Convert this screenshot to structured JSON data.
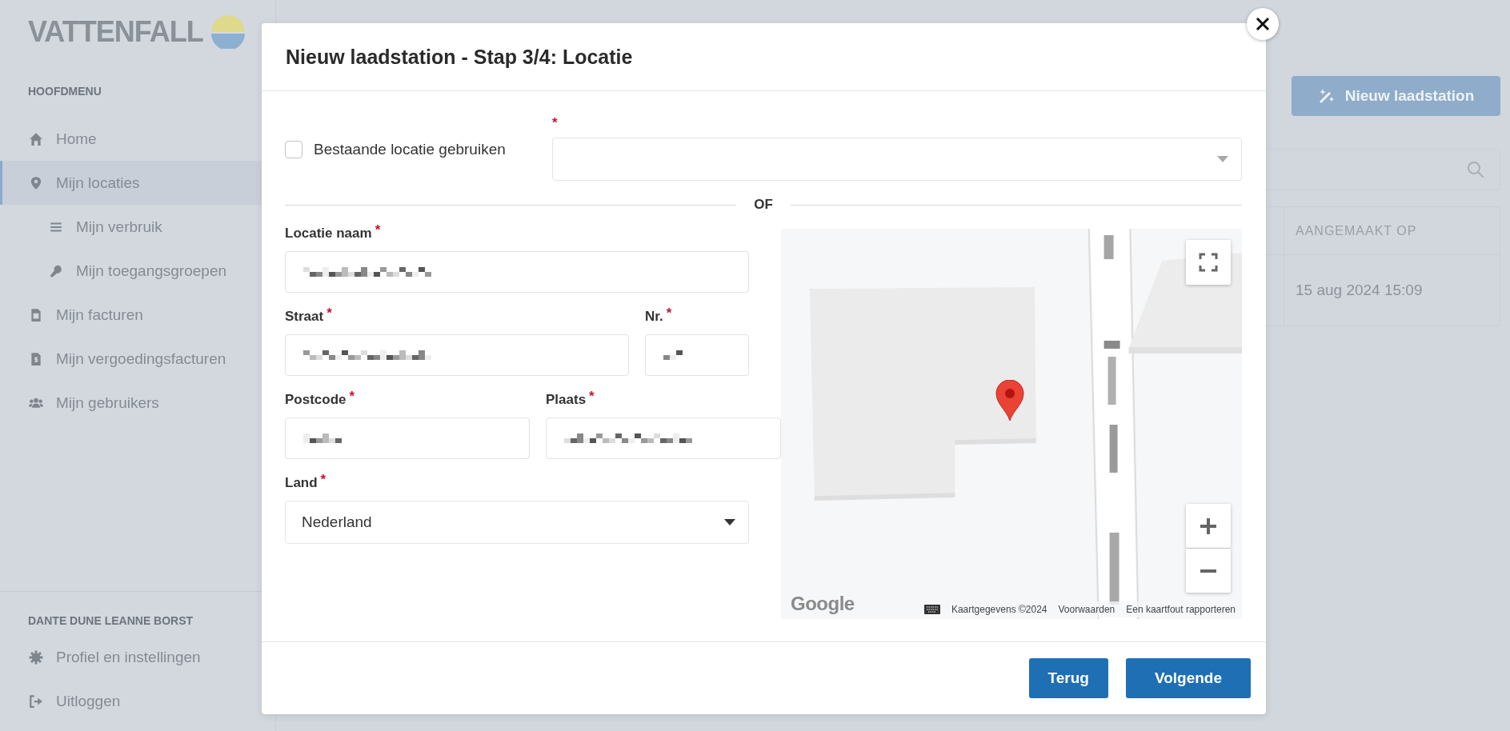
{
  "sidebar": {
    "logo": "VATTENFALL",
    "section_title": "HOOFDMENU",
    "items": [
      {
        "label": "Home",
        "selected": false
      },
      {
        "label": "Mijn locaties",
        "selected": true,
        "children": [
          {
            "label": "Mijn verbruik",
            "selected": false
          },
          {
            "label": "Mijn toegangsgroepen",
            "selected": false
          }
        ]
      },
      {
        "label": "Mijn facturen",
        "selected": false
      },
      {
        "label": "Mijn vergoedingsfacturen",
        "selected": false
      },
      {
        "label": "Mijn gebruikers",
        "selected": false
      }
    ],
    "user_title": "DANTE DUNE LEANNE BORST",
    "user_items": [
      {
        "label": "Profiel en instellingen"
      },
      {
        "label": "Uitloggen"
      }
    ]
  },
  "page": {
    "new_button": "Nieuw laadstation",
    "table": {
      "columns": [
        "AANGEMAAKT OP"
      ],
      "rows": [
        [
          "15 aug 2024 15:09"
        ]
      ]
    }
  },
  "modal": {
    "title": "Nieuw laadstation - Stap 3/4: Locatie",
    "existing": {
      "label": "Bestaande locatie gebruiken",
      "checked": false,
      "required_mark": "*"
    },
    "separator": "OF",
    "rows": [
      [
        {
          "label": "Locatie naam",
          "required_mark": "*",
          "pixelated": true
        }
      ],
      [
        {
          "label": "Straat",
          "required_mark": "*",
          "pixelated": true
        },
        {
          "label": "Nr.",
          "required_mark": "*",
          "pixelated": true
        }
      ],
      [
        {
          "label": "Postcode",
          "required_mark": "*",
          "pixelated": true
        },
        {
          "label": "Plaats",
          "required_mark": "*",
          "pixelated": true
        }
      ],
      [
        {
          "label": "Land",
          "required_mark": "*",
          "kind": "select",
          "value": "Nederland"
        }
      ]
    ],
    "map": {
      "logo": "Google",
      "attribution": [
        "Kaartgegevens ©2024",
        "Voorwaarden",
        "Een kaartfout rapporteren"
      ]
    },
    "buttons": [
      "Terug",
      "Volgende"
    ]
  }
}
